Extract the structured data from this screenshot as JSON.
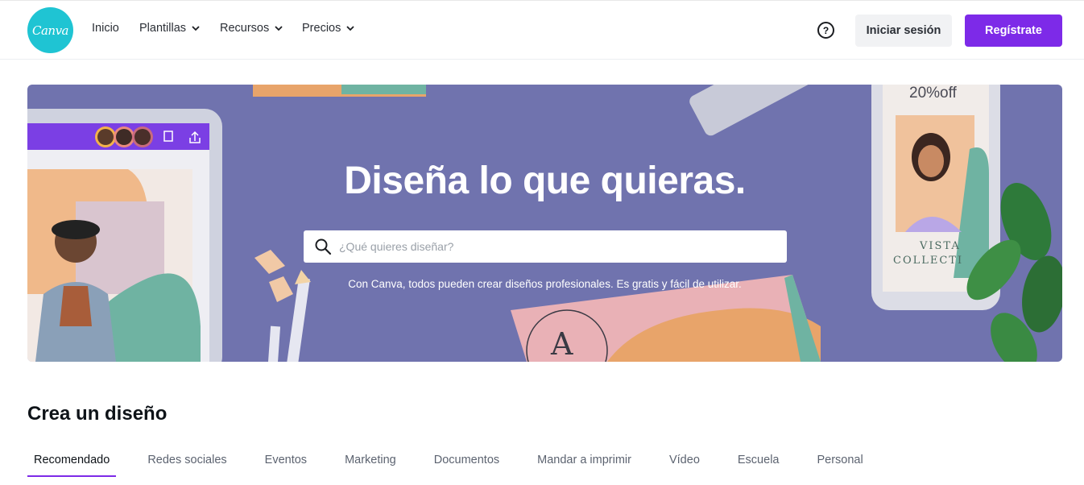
{
  "header": {
    "logo_text": "Canva",
    "nav": [
      {
        "label": "Inicio",
        "has_dropdown": false
      },
      {
        "label": "Plantillas",
        "has_dropdown": true
      },
      {
        "label": "Recursos",
        "has_dropdown": true
      },
      {
        "label": "Precios",
        "has_dropdown": true
      }
    ],
    "help_icon": "question-circle-icon",
    "login_label": "Iniciar sesión",
    "register_label": "Regístrate"
  },
  "hero": {
    "title": "Diseña lo que quieras.",
    "search_placeholder": "¿Qué quieres diseñar?",
    "subtitle": "Con Canva, todos pueden crear diseños profesionales. Es gratis y fácil de utilizar.",
    "phone_promo": "20%off",
    "phone_caption_line1": "VISTA",
    "phone_caption_line2": "COLLECTI",
    "card_letter": "A"
  },
  "create": {
    "title": "Crea un diseño",
    "tabs": [
      {
        "label": "Recomendado",
        "active": true
      },
      {
        "label": "Redes sociales",
        "active": false
      },
      {
        "label": "Eventos",
        "active": false
      },
      {
        "label": "Marketing",
        "active": false
      },
      {
        "label": "Documentos",
        "active": false
      },
      {
        "label": "Mandar a imprimir",
        "active": false
      },
      {
        "label": "Vídeo",
        "active": false
      },
      {
        "label": "Escuela",
        "active": false
      },
      {
        "label": "Personal",
        "active": false
      }
    ]
  },
  "colors": {
    "brand_purple": "#7d2ae8",
    "logo_teal": "#1fc4d3",
    "hero_bg": "#7073ae"
  }
}
